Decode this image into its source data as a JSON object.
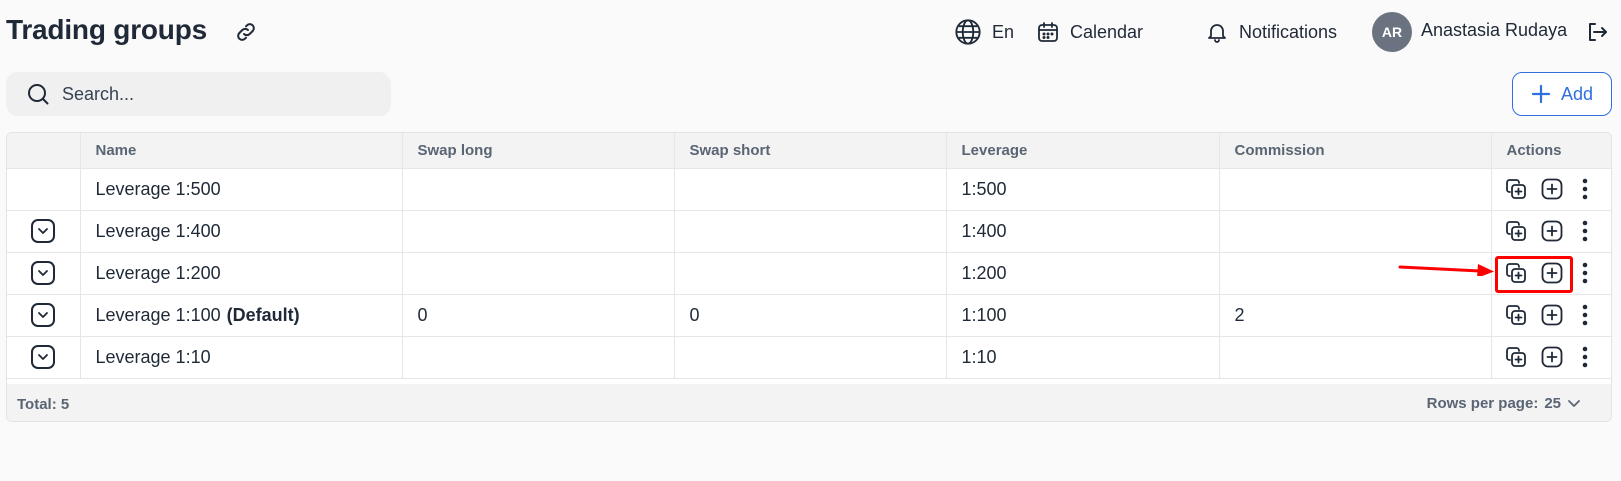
{
  "header": {
    "title": "Trading groups",
    "language": "En",
    "calendar": "Calendar",
    "notifications": "Notifications",
    "user": {
      "initials": "AR",
      "name": "Anastasia Rudaya"
    }
  },
  "search": {
    "placeholder": "Search..."
  },
  "toolbar": {
    "add_label": "Add"
  },
  "table": {
    "columns": [
      "",
      "Name",
      "Swap long",
      "Swap short",
      "Leverage",
      "Commission",
      "Actions"
    ],
    "rows": [
      {
        "name": "Leverage 1:500",
        "tag": "",
        "swap_long": "",
        "swap_short": "",
        "leverage": "1:500",
        "commission": ""
      },
      {
        "name": "Leverage 1:400",
        "tag": "",
        "swap_long": "",
        "swap_short": "",
        "leverage": "1:400",
        "commission": ""
      },
      {
        "name": "Leverage 1:200",
        "tag": "",
        "swap_long": "",
        "swap_short": "",
        "leverage": "1:200",
        "commission": ""
      },
      {
        "name": "Leverage 1:100",
        "tag": "(Default)",
        "swap_long": "0",
        "swap_short": "0",
        "leverage": "1:100",
        "commission": "2"
      },
      {
        "name": "Leverage 1:10",
        "tag": "",
        "swap_long": "",
        "swap_short": "",
        "leverage": "1:10",
        "commission": ""
      }
    ]
  },
  "footer": {
    "total": "Total: 5",
    "rows_per_page_label": "Rows per page:",
    "rows_per_page_value": "25"
  },
  "colors": {
    "accent": "#2f6fe0",
    "annotation": "#ff0000",
    "avatar_bg": "#6b7280"
  }
}
